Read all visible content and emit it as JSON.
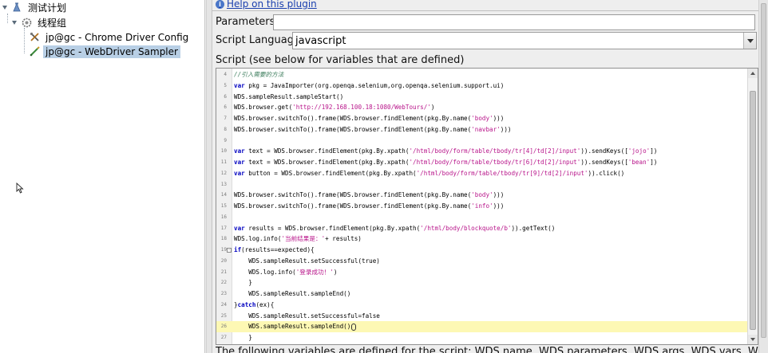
{
  "tree": {
    "items": [
      {
        "label": "测试计划",
        "icon": "test-plan-icon",
        "expanded": true
      },
      {
        "label": "线程组",
        "icon": "thread-group-icon",
        "expanded": true
      },
      {
        "label": "jp@gc - Chrome Driver Config",
        "icon": "config-element-icon"
      },
      {
        "label": "jp@gc - WebDriver Sampler",
        "icon": "sampler-icon",
        "selected": true
      }
    ]
  },
  "plugin": {
    "help_link": "Help on this plugin",
    "parameters_label": "Parameters:",
    "parameters_value": "",
    "script_language_label": "Script Language:",
    "script_language_value": "javascript",
    "script_label": "Script (see below for variables that are defined)",
    "variables_text": "The following variables are defined for the script: WDS.name, WDS.parameters, WDS.args, WDS.vars, WDS.ctx, WDS.p"
  },
  "script": {
    "lines": [
      {
        "no": "4",
        "text": "//引入需要的方法"
      },
      {
        "no": "5",
        "text": "var pkg = JavaImporter(org.openqa.selenium,org.openqa.selenium.support.ui)"
      },
      {
        "no": "6",
        "text": "WDS.sampleResult.sampleStart()"
      },
      {
        "no": "6",
        "text": "WDS.browser.get('http://192.168.100.18:1080/WebTours/')"
      },
      {
        "no": "7",
        "text": "WDS.browser.switchTo().frame(WDS.browser.findElement(pkg.By.name('body')))"
      },
      {
        "no": "8",
        "text": "WDS.browser.switchTo().frame(WDS.browser.findElement(pkg.By.name('navbar')))"
      },
      {
        "no": "9",
        "text": ""
      },
      {
        "no": "10",
        "text": "var text = WDS.browser.findElement(pkg.By.xpath('/html/body/form/table/tbody/tr[4]/td[2]/input')).sendKeys(['jojo'])"
      },
      {
        "no": "11",
        "text": "var text = WDS.browser.findElement(pkg.By.xpath('/html/body/form/table/tbody/tr[6]/td[2]/input')).sendKeys(['bean'])"
      },
      {
        "no": "12",
        "text": "var button = WDS.browser.findElement(pkg.By.xpath('/html/body/form/table/tbody/tr[9]/td[2]/input')).click()"
      },
      {
        "no": "13",
        "text": ""
      },
      {
        "no": "14",
        "text": "WDS.browser.switchTo().frame(WDS.browser.findElement(pkg.By.name('body')))"
      },
      {
        "no": "15",
        "text": "WDS.browser.switchTo().frame(WDS.browser.findElement(pkg.By.name('info')))"
      },
      {
        "no": "16",
        "text": ""
      },
      {
        "no": "17",
        "text": "var results = WDS.browser.findElement(pkg.By.xpath('/html/body/blockquote/b')).getText()"
      },
      {
        "no": "18",
        "text": "WDS.log.info('当前结果是：'+ results)"
      },
      {
        "no": "19",
        "text": "if(results==expected){",
        "fold": "-"
      },
      {
        "no": "20",
        "text": "    WDS.sampleResult.setSuccessful(true)"
      },
      {
        "no": "21",
        "text": "    WDS.log.info('登录成功！')"
      },
      {
        "no": "22",
        "text": "    }"
      },
      {
        "no": "23",
        "text": "    WDS.sampleResult.sampleEnd()"
      },
      {
        "no": "24",
        "text": "}catch(ex){"
      },
      {
        "no": "25",
        "text": "    WDS.sampleResult.setSuccessful=false"
      },
      {
        "no": "26",
        "text": "    WDS.sampleResult.sampleEnd()",
        "current": true
      },
      {
        "no": "27",
        "text": "    }"
      }
    ]
  },
  "colors": {
    "selection": "#b8cfe5",
    "current_line": "#fdf8b4",
    "keyword": "#0000c0",
    "comment": "#3f7f5f",
    "string": "#b8148a",
    "link": "#1a3fae"
  }
}
